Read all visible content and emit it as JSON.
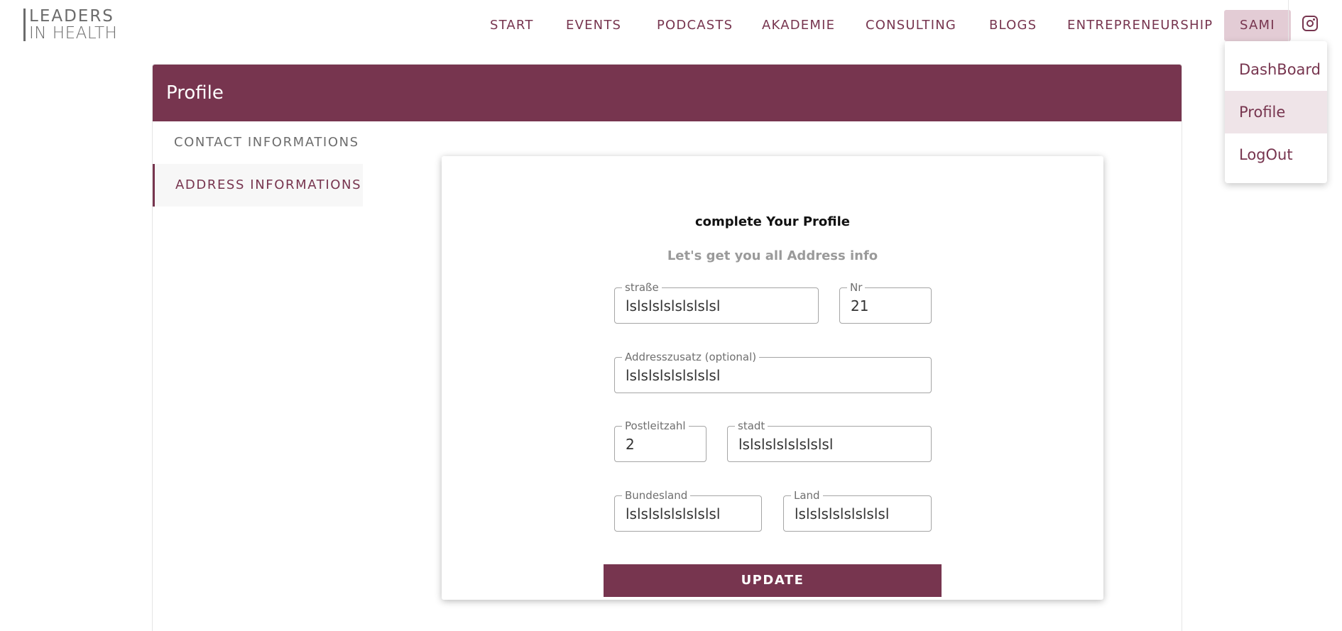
{
  "brand": {
    "line1": "LEADERS",
    "line2": "IN HEALTH"
  },
  "nav": {
    "items": [
      "START",
      "EVENTS",
      "PODCASTS",
      "AKADEMIE",
      "CONSULTING",
      "BLOGS",
      "ENTREPRENEURSHIP"
    ],
    "user": "SAMI",
    "instagram_icon": "instagram-icon"
  },
  "user_menu": {
    "items": [
      "DashBoard",
      "Profile",
      "LogOut"
    ],
    "active": "Profile"
  },
  "profile": {
    "title": "Profile",
    "tabs": [
      "CONTACT INFORMATIONS",
      "ADDRESS INFORMATIONS"
    ],
    "active_tab": "ADDRESS INFORMATIONS"
  },
  "form": {
    "title": "complete Your Profile",
    "subtitle": "Let's get you all Address info",
    "fields": {
      "strasse": {
        "label": "straße",
        "value": "lslslslslslslslsl"
      },
      "nr": {
        "label": "Nr",
        "value": "21"
      },
      "addresszusatz": {
        "label": "Addresszusatz (optional)",
        "value": "lslslslslslslslsl"
      },
      "postleitzahl": {
        "label": "Postleitzahl",
        "value": "2"
      },
      "stadt": {
        "label": "stadt",
        "value": "lslslslslslslslsl"
      },
      "bundesland": {
        "label": "Bundesland",
        "value": "lslslslslslslslsl"
      },
      "land": {
        "label": "Land",
        "value": "lslslslslslslslsl"
      }
    },
    "submit_label": "UPDATE"
  },
  "colors": {
    "brand": "#77354f",
    "active_nav_bg": "#e3ccd5",
    "logo": "#6b6b6b"
  }
}
